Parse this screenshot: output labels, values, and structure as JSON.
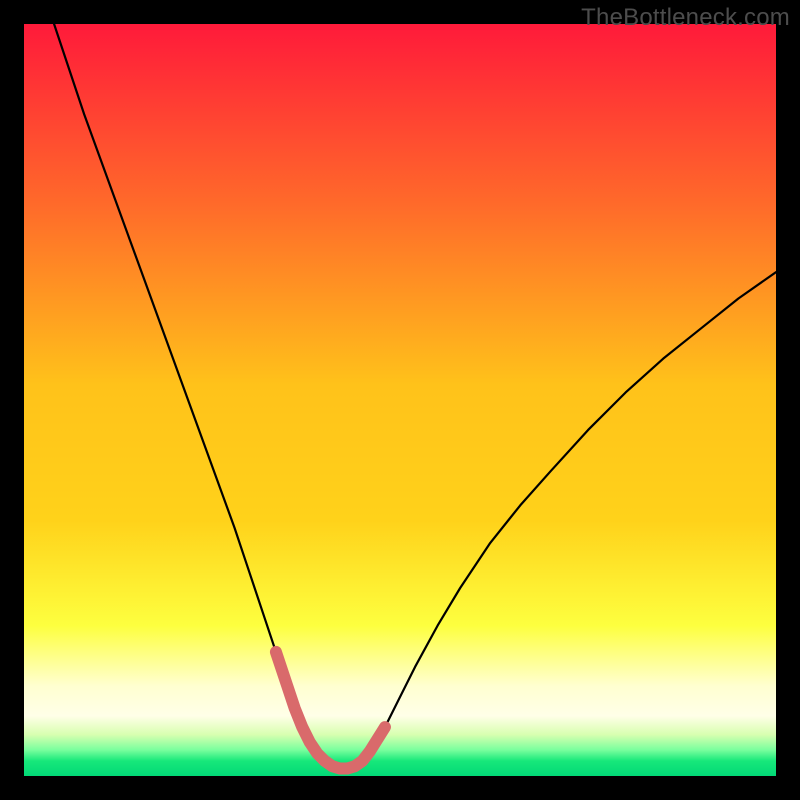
{
  "watermark": "TheBottleneck.com",
  "colors": {
    "background": "#000000",
    "curve": "#000000",
    "valleyStroke": "#d96a6b",
    "gradientTop": "#ff1a3a",
    "gradientMid1": "#ff8a1f",
    "gradientMid2": "#ffd21a",
    "gradientMid3": "#ffff2b",
    "gradientMid4": "#f5ffb3",
    "gradientPaleYellow": "#ffffd0",
    "gradientLightGreen": "#7bff9e",
    "gradientGreen": "#17e87a",
    "gradientBottom": "#02d977"
  },
  "chart_data": {
    "type": "line",
    "title": "",
    "xlabel": "",
    "ylabel": "",
    "xlim": [
      0,
      100
    ],
    "ylim": [
      0,
      100
    ],
    "x": [
      4,
      6,
      8,
      10,
      12,
      14,
      16,
      18,
      20,
      22,
      24,
      26,
      28,
      30,
      32,
      33.5,
      35,
      36,
      37,
      38,
      39,
      40,
      41,
      42,
      43,
      44,
      45,
      46,
      48,
      50,
      52,
      55,
      58,
      62,
      66,
      70,
      75,
      80,
      85,
      90,
      95,
      100
    ],
    "values": [
      100,
      94,
      88,
      82.5,
      77,
      71.5,
      66,
      60.5,
      55,
      49.5,
      44,
      38.5,
      33,
      27,
      21,
      16.5,
      12,
      9,
      6.5,
      4.5,
      3,
      2,
      1.3,
      1,
      1,
      1.3,
      2,
      3.3,
      6.5,
      10.5,
      14.5,
      20,
      25,
      31,
      36,
      40.5,
      46,
      51,
      55.5,
      59.5,
      63.5,
      67
    ],
    "valley_segment": {
      "x": [
        33.5,
        35,
        36,
        37,
        38,
        39,
        40,
        41,
        42,
        43,
        44,
        45,
        46,
        48
      ],
      "y": [
        16.5,
        12,
        9,
        6.5,
        4.5,
        3,
        2,
        1.3,
        1,
        1,
        1.3,
        2,
        3.3,
        6.5
      ]
    },
    "annotations": []
  }
}
